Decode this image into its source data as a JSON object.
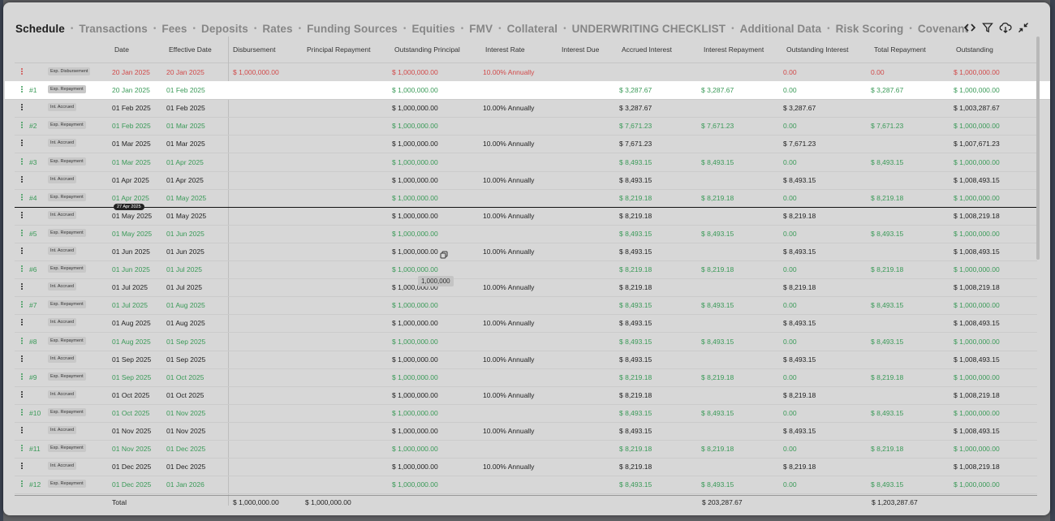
{
  "nav": {
    "tabs": [
      "Schedule",
      "Transactions",
      "Fees",
      "Deposits",
      "Rates",
      "Funding Sources",
      "Equities",
      "FMV",
      "Collateral",
      "UNDERWRITING CHECKLIST",
      "Additional Data",
      "Risk Scoring",
      "Covenant"
    ],
    "separator": "•"
  },
  "toolbar": {
    "icons": [
      "code-icon",
      "filter-icon",
      "cloud-download-icon",
      "collapse-icon"
    ]
  },
  "columns": [
    "Date",
    "Effective Date",
    "Disbursement",
    "Principal Repayment",
    "Outstanding Principal",
    "Interest Rate",
    "Interest Due",
    "Accrued Interest",
    "Interest Repayment",
    "Outstanding Interest",
    "Total Repayment",
    "Outstanding"
  ],
  "rows": [
    {
      "num": "",
      "type": "Exp. Disbursement",
      "date": "20 Jan 2025",
      "eff": "20 Jan 2025",
      "disb": "$ 1,000,000.00",
      "prin": "",
      "outp": "$ 1,000,000.00",
      "rate": "10.00% Annually",
      "due": "",
      "accr": "",
      "irep": "",
      "outi": "0.00",
      "trep": "0.00",
      "outs": "$ 1,000,000.00",
      "tone": "red"
    },
    {
      "num": "#1",
      "type": "Exp. Repayment",
      "date": "20 Jan 2025",
      "eff": "01 Feb 2025",
      "disb": "",
      "prin": "",
      "outp": "$ 1,000,000.00",
      "rate": "",
      "due": "",
      "accr": "$ 3,287.67",
      "irep": "$ 3,287.67",
      "outi": "0.00",
      "trep": "$ 3,287.67",
      "outs": "$ 1,000,000.00",
      "tone": "green",
      "highlight": true
    },
    {
      "num": "",
      "type": "Int. Accrued",
      "date": "01 Feb 2025",
      "eff": "01 Feb 2025",
      "disb": "",
      "prin": "",
      "outp": "$ 1,000,000.00",
      "rate": "10.00% Annually",
      "due": "",
      "accr": "$ 3,287.67",
      "irep": "",
      "outi": "$ 3,287.67",
      "trep": "",
      "outs": "$ 1,003,287.67",
      "tone": "neutral"
    },
    {
      "num": "#2",
      "type": "Exp. Repayment",
      "date": "01 Feb 2025",
      "eff": "01 Mar 2025",
      "disb": "",
      "prin": "",
      "outp": "$ 1,000,000.00",
      "rate": "",
      "due": "",
      "accr": "$ 7,671.23",
      "irep": "$ 7,671.23",
      "outi": "0.00",
      "trep": "$ 7,671.23",
      "outs": "$ 1,000,000.00",
      "tone": "green"
    },
    {
      "num": "",
      "type": "Int. Accrued",
      "date": "01 Mar 2025",
      "eff": "01 Mar 2025",
      "disb": "",
      "prin": "",
      "outp": "$ 1,000,000.00",
      "rate": "10.00% Annually",
      "due": "",
      "accr": "$ 7,671.23",
      "irep": "",
      "outi": "$ 7,671.23",
      "trep": "",
      "outs": "$ 1,007,671.23",
      "tone": "neutral"
    },
    {
      "num": "#3",
      "type": "Exp. Repayment",
      "date": "01 Mar 2025",
      "eff": "01 Apr 2025",
      "disb": "",
      "prin": "",
      "outp": "$ 1,000,000.00",
      "rate": "",
      "due": "",
      "accr": "$ 8,493.15",
      "irep": "$ 8,493.15",
      "outi": "0.00",
      "trep": "$ 8,493.15",
      "outs": "$ 1,000,000.00",
      "tone": "green"
    },
    {
      "num": "",
      "type": "Int. Accrued",
      "date": "01 Apr 2025",
      "eff": "01 Apr 2025",
      "disb": "",
      "prin": "",
      "outp": "$ 1,000,000.00",
      "rate": "10.00% Annually",
      "due": "",
      "accr": "$ 8,493.15",
      "irep": "",
      "outi": "$ 8,493.15",
      "trep": "",
      "outs": "$ 1,008,493.15",
      "tone": "neutral"
    },
    {
      "num": "#4",
      "type": "Exp. Repayment",
      "date": "01 Apr 2025",
      "eff": "01 May 2025",
      "disb": "",
      "prin": "",
      "outp": "$ 1,000,000.00",
      "rate": "",
      "due": "",
      "accr": "$ 8,219.18",
      "irep": "$ 8,219.18",
      "outi": "0.00",
      "trep": "$ 8,219.18",
      "outs": "$ 1,000,000.00",
      "tone": "green"
    },
    {
      "num": "",
      "type": "Int. Accrued",
      "date": "01 May 2025",
      "eff": "01 May 2025",
      "disb": "",
      "prin": "",
      "outp": "$ 1,000,000.00",
      "rate": "10.00% Annually",
      "due": "",
      "accr": "$ 8,219.18",
      "irep": "",
      "outi": "$ 8,219.18",
      "trep": "",
      "outs": "$ 1,008,219.18",
      "tone": "neutral"
    },
    {
      "num": "#5",
      "type": "Exp. Repayment",
      "date": "01 May 2025",
      "eff": "01 Jun 2025",
      "disb": "",
      "prin": "",
      "outp": "$ 1,000,000.00",
      "rate": "",
      "due": "",
      "accr": "$ 8,493.15",
      "irep": "$ 8,493.15",
      "outi": "0.00",
      "trep": "$ 8,493.15",
      "outs": "$ 1,000,000.00",
      "tone": "green"
    },
    {
      "num": "",
      "type": "Int. Accrued",
      "date": "01 Jun 2025",
      "eff": "01 Jun 2025",
      "disb": "",
      "prin": "",
      "outp": "$ 1,000,000.00",
      "rate": "10.00% Annually",
      "due": "",
      "accr": "$ 8,493.15",
      "irep": "",
      "outi": "$ 8,493.15",
      "trep": "",
      "outs": "$ 1,008,493.15",
      "tone": "neutral"
    },
    {
      "num": "#6",
      "type": "Exp. Repayment",
      "date": "01 Jun 2025",
      "eff": "01 Jul 2025",
      "disb": "",
      "prin": "",
      "outp": "$ 1,000,000.00",
      "rate": "",
      "due": "",
      "accr": "$ 8,219.18",
      "irep": "$ 8,219.18",
      "outi": "0.00",
      "trep": "$ 8,219.18",
      "outs": "$ 1,000,000.00",
      "tone": "green"
    },
    {
      "num": "",
      "type": "Int. Accrued",
      "date": "01 Jul 2025",
      "eff": "01 Jul 2025",
      "disb": "",
      "prin": "",
      "outp": "$ 1,000,000.00",
      "rate": "10.00% Annually",
      "due": "",
      "accr": "$ 8,219.18",
      "irep": "",
      "outi": "$ 8,219.18",
      "trep": "",
      "outs": "$ 1,008,219.18",
      "tone": "neutral"
    },
    {
      "num": "#7",
      "type": "Exp. Repayment",
      "date": "01 Jul 2025",
      "eff": "01 Aug 2025",
      "disb": "",
      "prin": "",
      "outp": "$ 1,000,000.00",
      "rate": "",
      "due": "",
      "accr": "$ 8,493.15",
      "irep": "$ 8,493.15",
      "outi": "0.00",
      "trep": "$ 8,493.15",
      "outs": "$ 1,000,000.00",
      "tone": "green"
    },
    {
      "num": "",
      "type": "Int. Accrued",
      "date": "01 Aug 2025",
      "eff": "01 Aug 2025",
      "disb": "",
      "prin": "",
      "outp": "$ 1,000,000.00",
      "rate": "10.00% Annually",
      "due": "",
      "accr": "$ 8,493.15",
      "irep": "",
      "outi": "$ 8,493.15",
      "trep": "",
      "outs": "$ 1,008,493.15",
      "tone": "neutral"
    },
    {
      "num": "#8",
      "type": "Exp. Repayment",
      "date": "01 Aug 2025",
      "eff": "01 Sep 2025",
      "disb": "",
      "prin": "",
      "outp": "$ 1,000,000.00",
      "rate": "",
      "due": "",
      "accr": "$ 8,493.15",
      "irep": "$ 8,493.15",
      "outi": "0.00",
      "trep": "$ 8,493.15",
      "outs": "$ 1,000,000.00",
      "tone": "green"
    },
    {
      "num": "",
      "type": "Int. Accrued",
      "date": "01 Sep 2025",
      "eff": "01 Sep 2025",
      "disb": "",
      "prin": "",
      "outp": "$ 1,000,000.00",
      "rate": "10.00% Annually",
      "due": "",
      "accr": "$ 8,493.15",
      "irep": "",
      "outi": "$ 8,493.15",
      "trep": "",
      "outs": "$ 1,008,493.15",
      "tone": "neutral"
    },
    {
      "num": "#9",
      "type": "Exp. Repayment",
      "date": "01 Sep 2025",
      "eff": "01 Oct 2025",
      "disb": "",
      "prin": "",
      "outp": "$ 1,000,000.00",
      "rate": "",
      "due": "",
      "accr": "$ 8,219.18",
      "irep": "$ 8,219.18",
      "outi": "0.00",
      "trep": "$ 8,219.18",
      "outs": "$ 1,000,000.00",
      "tone": "green"
    },
    {
      "num": "",
      "type": "Int. Accrued",
      "date": "01 Oct 2025",
      "eff": "01 Oct 2025",
      "disb": "",
      "prin": "",
      "outp": "$ 1,000,000.00",
      "rate": "10.00% Annually",
      "due": "",
      "accr": "$ 8,219.18",
      "irep": "",
      "outi": "$ 8,219.18",
      "trep": "",
      "outs": "$ 1,008,219.18",
      "tone": "neutral"
    },
    {
      "num": "#10",
      "type": "Exp. Repayment",
      "date": "01 Oct 2025",
      "eff": "01 Nov 2025",
      "disb": "",
      "prin": "",
      "outp": "$ 1,000,000.00",
      "rate": "",
      "due": "",
      "accr": "$ 8,493.15",
      "irep": "$ 8,493.15",
      "outi": "0.00",
      "trep": "$ 8,493.15",
      "outs": "$ 1,000,000.00",
      "tone": "green"
    },
    {
      "num": "",
      "type": "Int. Accrued",
      "date": "01 Nov 2025",
      "eff": "01 Nov 2025",
      "disb": "",
      "prin": "",
      "outp": "$ 1,000,000.00",
      "rate": "10.00% Annually",
      "due": "",
      "accr": "$ 8,493.15",
      "irep": "",
      "outi": "$ 8,493.15",
      "trep": "",
      "outs": "$ 1,008,493.15",
      "tone": "neutral"
    },
    {
      "num": "#11",
      "type": "Exp. Repayment",
      "date": "01 Nov 2025",
      "eff": "01 Dec 2025",
      "disb": "",
      "prin": "",
      "outp": "$ 1,000,000.00",
      "rate": "",
      "due": "",
      "accr": "$ 8,219.18",
      "irep": "$ 8,219.18",
      "outi": "0.00",
      "trep": "$ 8,219.18",
      "outs": "$ 1,000,000.00",
      "tone": "green"
    },
    {
      "num": "",
      "type": "Int. Accrued",
      "date": "01 Dec 2025",
      "eff": "01 Dec 2025",
      "disb": "",
      "prin": "",
      "outp": "$ 1,000,000.00",
      "rate": "10.00% Annually",
      "due": "",
      "accr": "$ 8,219.18",
      "irep": "",
      "outi": "$ 8,219.18",
      "trep": "",
      "outs": "$ 1,008,219.18",
      "tone": "neutral"
    },
    {
      "num": "#12",
      "type": "Exp. Repayment",
      "date": "01 Dec 2025",
      "eff": "01 Jan 2026",
      "disb": "",
      "prin": "",
      "outp": "$ 1,000,000.00",
      "rate": "",
      "due": "",
      "accr": "$ 8,493.15",
      "irep": "$ 8,493.15",
      "outi": "0.00",
      "trep": "$ 8,493.15",
      "outs": "$ 1,000,000.00",
      "tone": "green"
    }
  ],
  "today_marker": {
    "label": "27 Apr 2025"
  },
  "tooltip": {
    "text": "1,000,000"
  },
  "totals": {
    "label": "Total",
    "disb": "$ 1,000,000.00",
    "prin": "$ 1,000,000.00",
    "irep": "$ 203,287.67",
    "trep": "$ 1,203,287.67"
  },
  "colors": {
    "green": "#3a9a58",
    "red": "#d14a4a",
    "highlight": "#ffffff",
    "panel": "#d7d7d7"
  }
}
